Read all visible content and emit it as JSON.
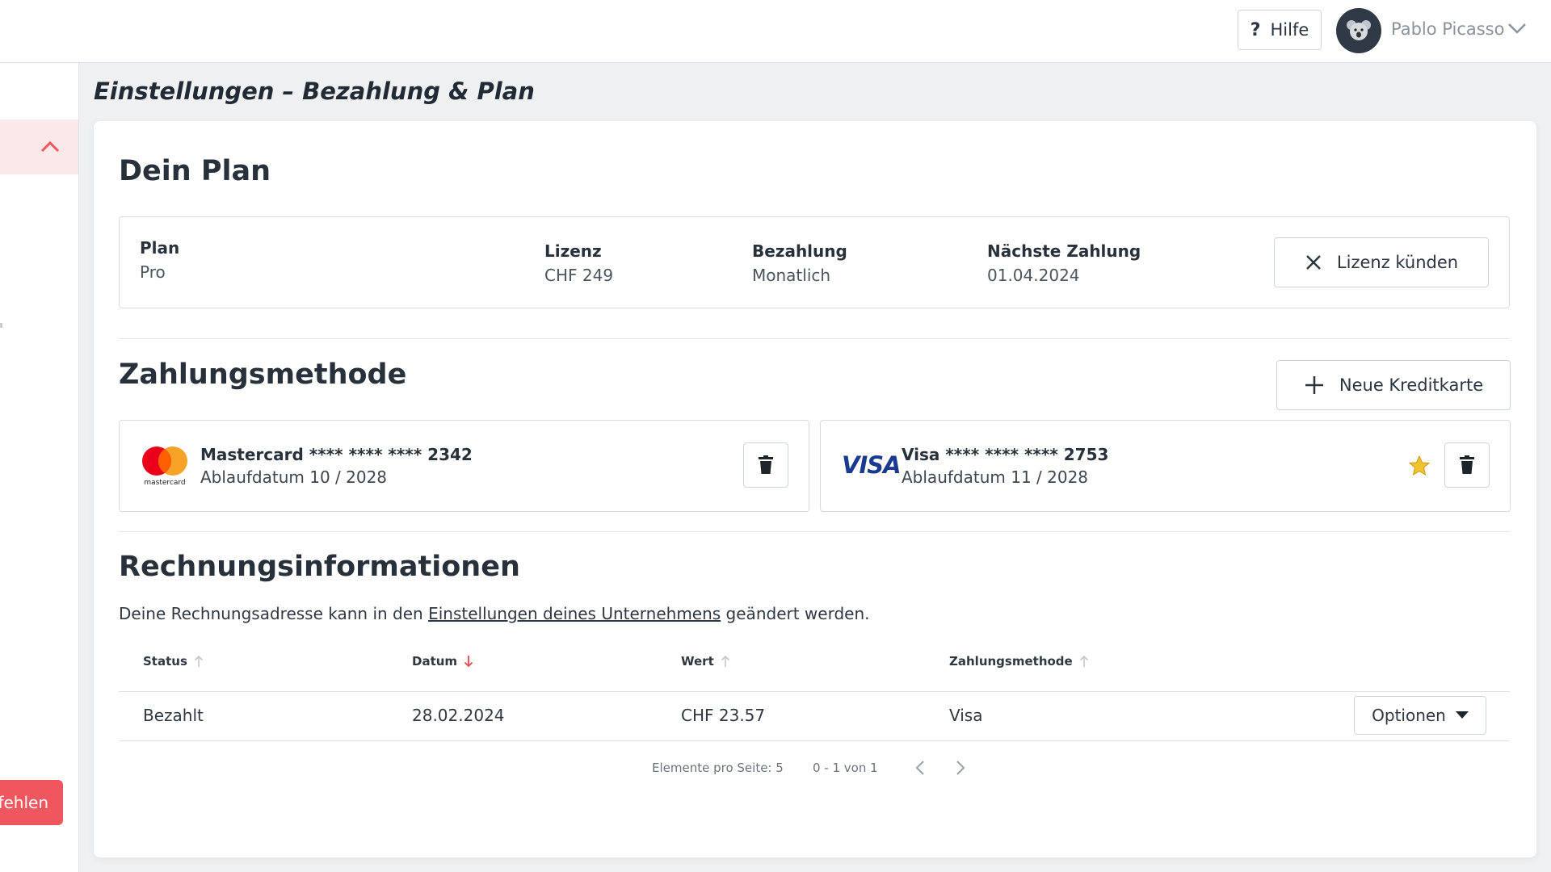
{
  "header": {
    "help_label": "Hilfe",
    "help_icon": "question-icon",
    "user_name": "Pablo Picasso"
  },
  "sidebar": {
    "action_label": "fehlen"
  },
  "page": {
    "title": "Einstellungen – Bezahlung & Plan"
  },
  "plan": {
    "heading": "Dein Plan",
    "fields": [
      {
        "label": "Plan",
        "value": "Pro"
      },
      {
        "label": "Lizenz",
        "value": "CHF 249"
      },
      {
        "label": "Bezahlung",
        "value": "Monatlich"
      },
      {
        "label": "Nächste Zahlung",
        "value": "01.04.2024"
      }
    ],
    "cancel_label": "Lizenz künden"
  },
  "payment": {
    "heading": "Zahlungsmethode",
    "add_label": "Neue Kreditkarte",
    "cards": [
      {
        "brand": "Mastercard",
        "title": "Mastercard **** **** **** 2342",
        "expiry": "Ablaufdatum 10 / 2028",
        "logo_text": "mastercard"
      },
      {
        "brand": "Visa",
        "title": "Visa **** **** **** 2753",
        "expiry": "Ablaufdatum 11 / 2028",
        "logo_text": "VISA",
        "default": true
      }
    ]
  },
  "billing": {
    "heading": "Rechnungsinformationen",
    "info_prefix": "Deine Rechnungsadresse kann in den ",
    "info_link": "Einstellungen deines Unternehmens",
    "info_suffix": " geändert werden.",
    "columns": [
      "Status",
      "Datum",
      "Wert",
      "Zahlungsmethode"
    ],
    "rows": [
      {
        "status": "Bezahlt",
        "date": "28.02.2024",
        "value": "CHF 23.57",
        "method": "Visa"
      }
    ],
    "options_label": "Optionen",
    "per_page": "Elemente pro Seite: 5",
    "range": "0 - 1 von 1"
  },
  "colors": {
    "accent": "#f0565d",
    "star": "#f2c230"
  }
}
